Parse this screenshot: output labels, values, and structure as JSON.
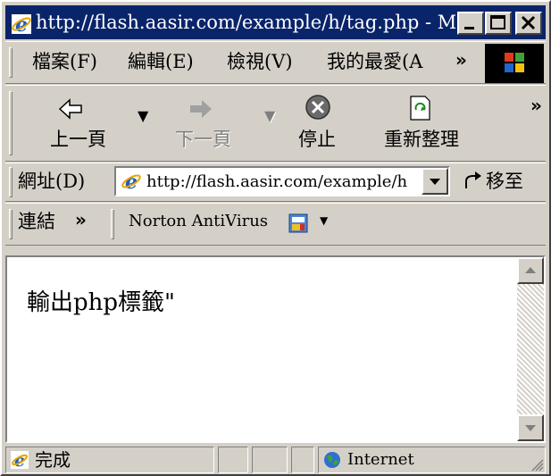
{
  "window": {
    "title": "http://flash.aasir.com/example/h/tag.php - Micr...",
    "buttons": {
      "minimize": "minimize",
      "maximize": "maximize",
      "close": "close"
    }
  },
  "menubar": {
    "items": [
      {
        "label": "檔案(F)"
      },
      {
        "label": "編輯(E)"
      },
      {
        "label": "檢視(V)"
      },
      {
        "label": "我的最愛(A"
      }
    ],
    "more": "»"
  },
  "toolbar": {
    "back": "上一頁",
    "forward": "下一頁",
    "stop": "停止",
    "refresh": "重新整理",
    "more": "»"
  },
  "address": {
    "label": "網址(D)",
    "value": "http://flash.aasir.com/example/h",
    "go": "移至"
  },
  "links": {
    "label": "連結",
    "more": "»",
    "norton": "Norton AntiVirus"
  },
  "content": {
    "text": "輸出php標籤\""
  },
  "status": {
    "text": "完成",
    "zone": "Internet"
  },
  "colors": {
    "title_bar": "#0a246a",
    "face": "#d4d0c8"
  }
}
